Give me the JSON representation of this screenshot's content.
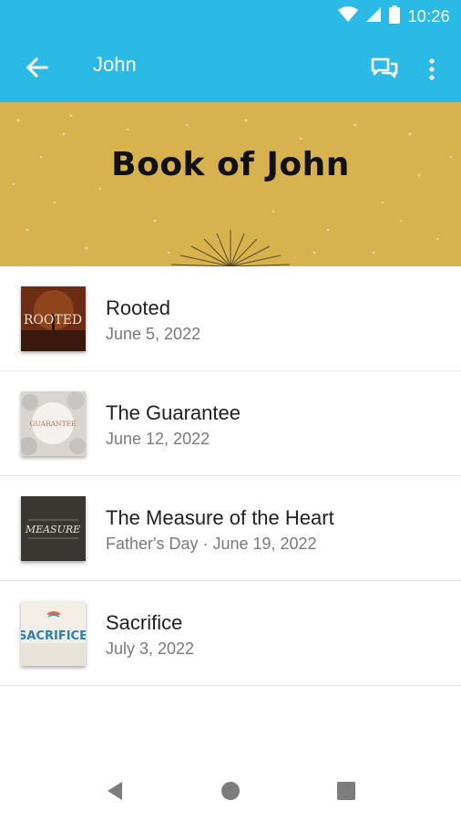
{
  "status_bar": {
    "time": "10:26"
  },
  "app_bar": {
    "title": "John"
  },
  "banner": {
    "title": "Book of John"
  },
  "sermons": [
    {
      "title": "Rooted",
      "subtitle": "June 5, 2022",
      "thumb_text": "ROOTED"
    },
    {
      "title": "The Guarantee",
      "subtitle": "June 12, 2022",
      "thumb_text": "GUARANTEE"
    },
    {
      "title": "The Measure of the Heart",
      "subtitle": "Father's Day · June 19, 2022",
      "thumb_text": "MEASURE"
    },
    {
      "title": "Sacrifice",
      "subtitle": "July 3, 2022",
      "thumb_text": "SACRIFICE"
    }
  ],
  "colors": {
    "primary": "#2bb9e6",
    "banner": "#d8b24e"
  }
}
